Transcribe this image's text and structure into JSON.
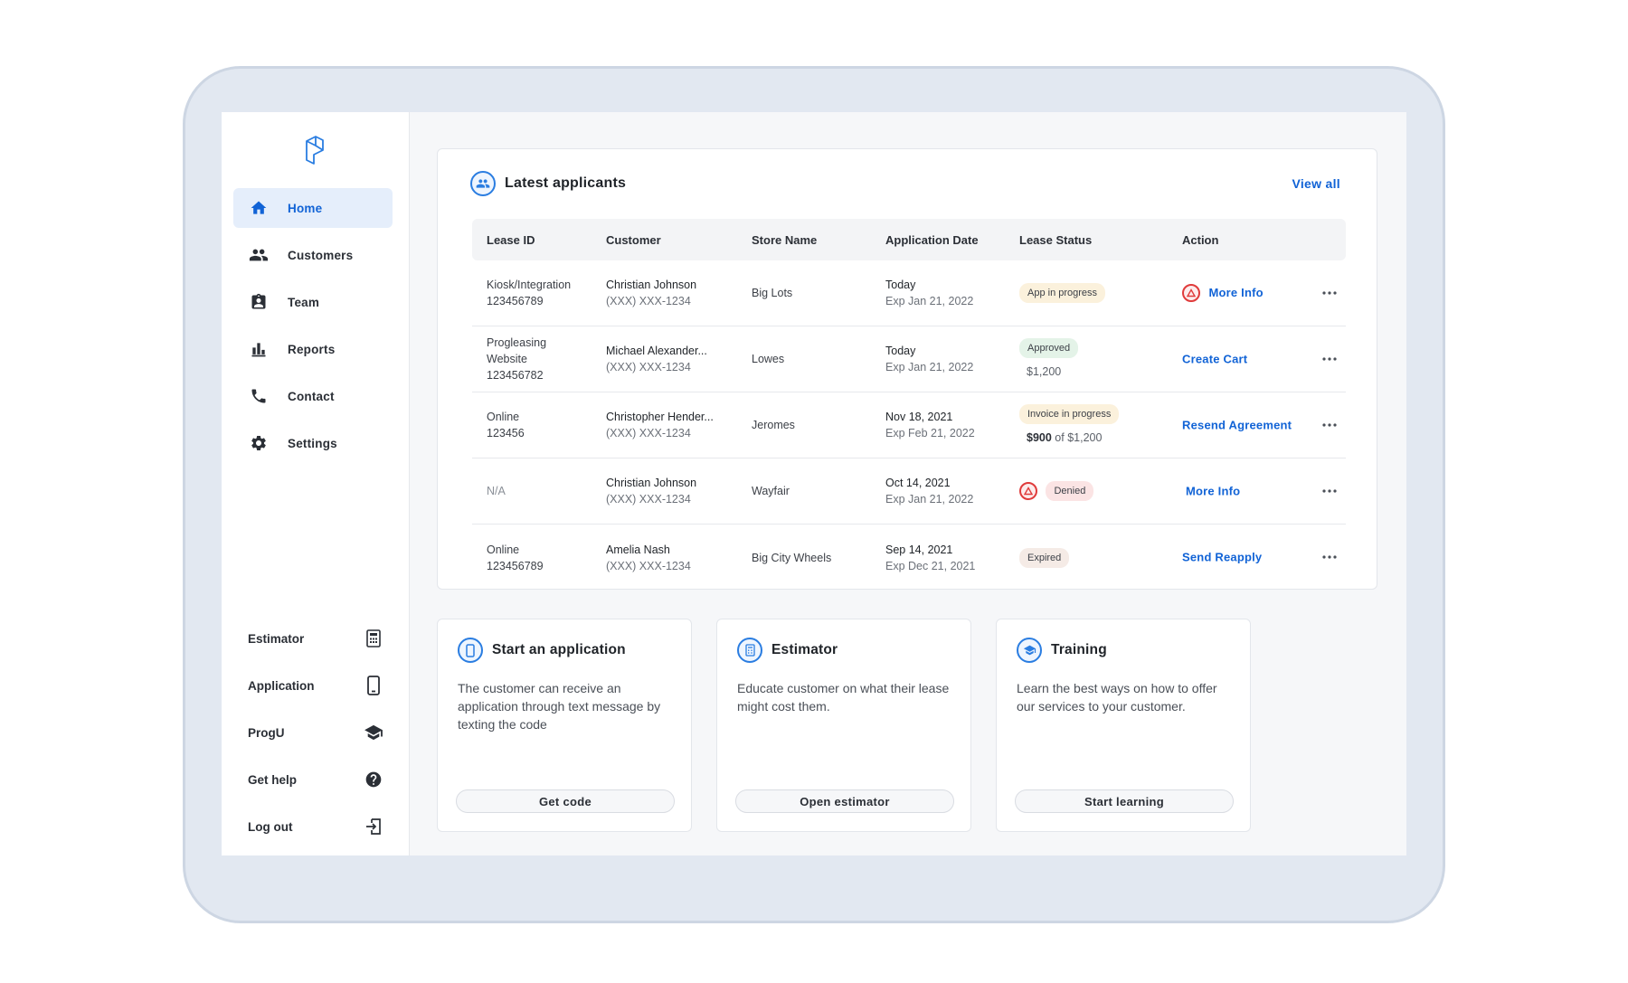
{
  "sidebar": {
    "logo": "prog-logo",
    "items": [
      {
        "label": "Home",
        "icon": "home-icon",
        "active": true
      },
      {
        "label": "Customers",
        "icon": "people-icon"
      },
      {
        "label": "Team",
        "icon": "badge-icon"
      },
      {
        "label": "Reports",
        "icon": "bar-chart-icon"
      },
      {
        "label": "Contact",
        "icon": "phone-icon"
      },
      {
        "label": "Settings",
        "icon": "gear-icon"
      }
    ],
    "bottom_items": [
      {
        "label": "Estimator",
        "icon": "calculator-icon"
      },
      {
        "label": "Application",
        "icon": "mobile-icon"
      },
      {
        "label": "ProgU",
        "icon": "graduation-cap-icon"
      },
      {
        "label": "Get help",
        "icon": "help-icon"
      },
      {
        "label": "Log out",
        "icon": "logout-icon"
      }
    ]
  },
  "applicants": {
    "title": "Latest applicants",
    "view_all": "View all",
    "columns": [
      "Lease ID",
      "Customer",
      "Store Name",
      "Application Date",
      "Lease Status",
      "Action"
    ],
    "rows": [
      {
        "lease_line1": "Kiosk/Integration",
        "lease_line2": "123456789",
        "customer": "Christian Johnson",
        "phone": "(XXX) XXX-1234",
        "store": "Big Lots",
        "date": "Today",
        "exp": "Exp Jan 21, 2022",
        "status": "App in progress",
        "amount_paid": "",
        "amount_of": "",
        "action": "More Info",
        "action_alert": true
      },
      {
        "lease_line1": "Progleasing",
        "lease_line2": "Website",
        "lease_line3": "123456782",
        "customer": "Michael Alexander...",
        "phone": "(XXX) XXX-1234",
        "store": "Lowes",
        "date": "Today",
        "exp": "Exp Jan 21, 2022",
        "status": "Approved",
        "amount_paid": "$1,200",
        "amount_of": "",
        "action": "Create Cart",
        "action_alert": false
      },
      {
        "lease_line1": "Online",
        "lease_line2": "123456",
        "customer": "Christopher Hender...",
        "phone": "(XXX) XXX-1234",
        "store": "Jeromes",
        "date": "Nov 18, 2021",
        "exp": "Exp Feb 21, 2022",
        "status": "Invoice in progress",
        "amount_paid": "$900",
        "amount_of": "of $1,200",
        "action": "Resend Agreement",
        "action_alert": false
      },
      {
        "lease_line1": "N/A",
        "lease_line2": "",
        "customer": "Christian Johnson",
        "phone": "(XXX) XXX-1234",
        "store": "Wayfair",
        "date": "Oct 14, 2021",
        "exp": "Exp Jan 21, 2022",
        "status": "Denied",
        "status_alert": true,
        "action": "More Info",
        "action_alert": false
      },
      {
        "lease_line1": "Online",
        "lease_line2": "123456789",
        "customer": "Amelia Nash",
        "phone": "(XXX) XXX-1234",
        "store": "Big City Wheels",
        "date": "Sep 14, 2021",
        "exp": "Exp Dec 21, 2021",
        "status": "Expired",
        "action": "Send Reapply",
        "action_alert": false
      }
    ]
  },
  "cards": [
    {
      "title": "Start an application",
      "icon": "mobile-icon",
      "desc": "The customer can receive an application through text message by texting the code",
      "button": "Get code"
    },
    {
      "title": "Estimator",
      "icon": "calculator-icon",
      "desc": "Educate customer on what their lease might cost them.",
      "button": "Open estimator"
    },
    {
      "title": "Training",
      "icon": "graduation-cap-icon",
      "desc": "Learn the best ways on how to offer our services to your customer.",
      "button": "Start learning"
    }
  ],
  "colors": {
    "accent": "#1163d6",
    "alert": "#e03b3b"
  }
}
